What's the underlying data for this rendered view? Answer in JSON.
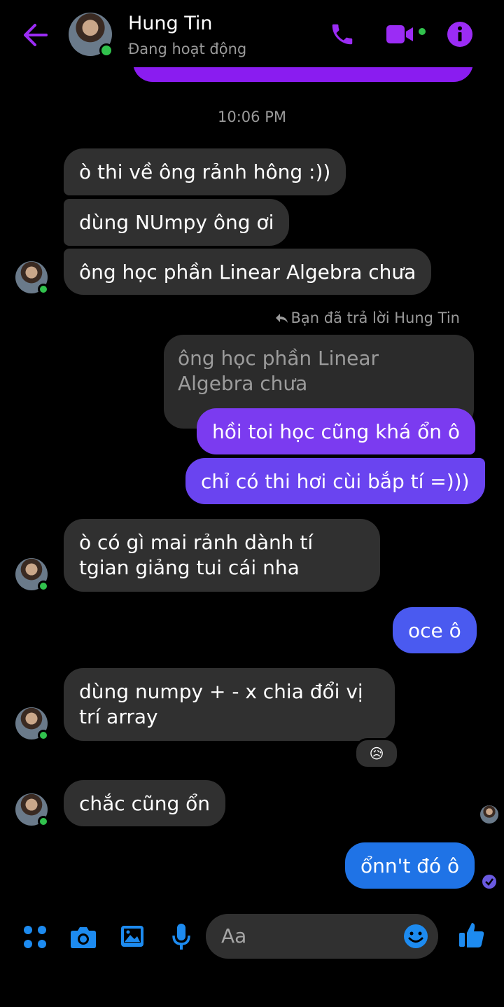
{
  "header": {
    "contact_name": "Hung Tin",
    "status": "Đang hoạt động"
  },
  "timestamp": "10:06 PM",
  "messages": {
    "m1": "ò thi về ông rảnh hông :))",
    "m2": "dùng NUmpy ông ơi",
    "m3": "ông học phần Linear Algebra chưa",
    "reply_label": "Bạn đã trả lời Hung Tin",
    "quoted": "ông học phần Linear Algebra chưa",
    "m4": "hồi toi học cũng khá ổn ô",
    "m5": "chỉ có thi hơi cùi bắp tí =)))",
    "m6": "ò có gì mai rảnh dành tí tgian giảng tui cái nha",
    "m7": "oce ô",
    "m8": "dùng numpy + - x chia đổi vị trí array",
    "reaction": "😥",
    "m9": "chắc cũng ổn",
    "m10": "ổnn't đó ô"
  },
  "composer": {
    "placeholder": "Aa"
  },
  "colors": {
    "accent_purple": "#8a1cf0",
    "bubble_incoming": "#303030",
    "bubble_out_top": "#7b3bf0",
    "bubble_out_mid": "#5b4ff0",
    "bubble_out_bottom": "#1f73e6",
    "composer_blue": "#1d8bf0"
  }
}
